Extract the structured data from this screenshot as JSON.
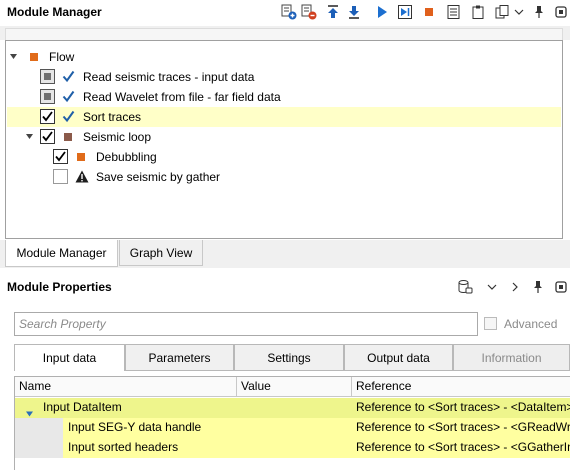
{
  "module_manager": {
    "title": "Module Manager",
    "toolbar": [
      {
        "name": "add-module-icon",
        "color": "#1c5fb8"
      },
      {
        "name": "remove-module-icon",
        "color": "#d04020"
      },
      {
        "name": "move-up-icon",
        "color": "#1c5fb8"
      },
      {
        "name": "move-down-icon",
        "color": "#1c5fb8"
      },
      {
        "name": "run-icon",
        "color": "#1c6fd0"
      },
      {
        "name": "run-step-icon",
        "color": "#1c6fd0"
      },
      {
        "name": "stop-icon",
        "color": "#e0601c"
      },
      {
        "name": "list-icon",
        "color": "#333333"
      },
      {
        "name": "clipboard-icon",
        "color": "#333333"
      },
      {
        "name": "copy-icon",
        "color": "#333333"
      },
      {
        "name": "chevron-down-icon",
        "color": "#333333"
      },
      {
        "name": "pin-icon",
        "color": "#333333"
      },
      {
        "name": "maximize-icon",
        "color": "#333333"
      }
    ],
    "tree": [
      {
        "label": "Flow",
        "level": 0,
        "arrow": "down",
        "checkbox": "none",
        "check": false,
        "square": "#e06b1a",
        "selected": false
      },
      {
        "label": "Read seismic traces - input data",
        "level": 1,
        "arrow": "none",
        "checkbox": "grey",
        "check": true,
        "square": "",
        "selected": false
      },
      {
        "label": "Read Wavelet from file - far field data",
        "level": 1,
        "arrow": "none",
        "checkbox": "grey",
        "check": true,
        "square": "",
        "selected": false
      },
      {
        "label": "Sort traces",
        "level": 1,
        "arrow": "none",
        "checkbox": "checked",
        "check": true,
        "square": "",
        "selected": true
      },
      {
        "label": "Seismic loop",
        "level": 1,
        "arrow": "down",
        "checkbox": "checked",
        "check": false,
        "square": "#8b5a4a",
        "selected": false
      },
      {
        "label": "Debubbling",
        "level": 2,
        "arrow": "none",
        "checkbox": "checked",
        "check": false,
        "square": "#e06b1a",
        "selected": false
      },
      {
        "label": "Save seismic by gather",
        "level": 2,
        "arrow": "none",
        "checkbox": "empty",
        "check": false,
        "square": "warning",
        "selected": false
      }
    ],
    "tabs": [
      {
        "label": "Module Manager",
        "active": true
      },
      {
        "label": "Graph View",
        "active": false
      }
    ]
  },
  "module_properties": {
    "title": "Module Properties",
    "toolbar": [
      "database-icon",
      "chevron-down-icon",
      "chevron-right-icon",
      "pin-icon",
      "maximize-icon"
    ],
    "search_placeholder": "Search Property",
    "advanced_label": "Advanced",
    "tabs": [
      {
        "label": "Input data",
        "active": true,
        "disabled": false
      },
      {
        "label": "Parameters",
        "active": false,
        "disabled": false
      },
      {
        "label": "Settings",
        "active": false,
        "disabled": false
      },
      {
        "label": "Output data",
        "active": false,
        "disabled": false
      },
      {
        "label": "Information",
        "active": false,
        "disabled": true
      }
    ],
    "columns": [
      "Name",
      "Value",
      "Reference"
    ],
    "rows": [
      {
        "name": "Input DataItem",
        "value": "",
        "reference": "Reference to <Sort traces> - <DataItem>",
        "level": 0,
        "expand": true
      },
      {
        "name": "Input SEG-Y data handle",
        "value": "",
        "reference": "Reference to <Sort traces> - <GReadWriteSegYDataHandle>",
        "level": 1,
        "expand": false
      },
      {
        "name": "Input sorted headers",
        "value": "",
        "reference": "Reference to <Sort traces> - <GGatherInfo>",
        "level": 1,
        "expand": false
      }
    ]
  }
}
